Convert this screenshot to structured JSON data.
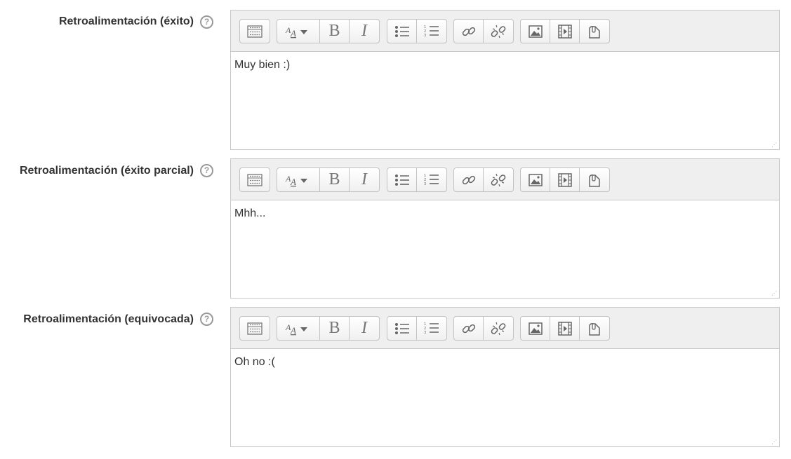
{
  "fields": [
    {
      "label": "Retroalimentación (éxito)",
      "help": "?",
      "content": "Muy bien :)"
    },
    {
      "label": "Retroalimentación (éxito parcial)",
      "help": "?",
      "content": "Mhh..."
    },
    {
      "label": "Retroalimentación (equivocada)",
      "help": "?",
      "content": "Oh no :("
    }
  ],
  "toolbar": {
    "icons": [
      "show-more-buttons-icon",
      "font-style-icon",
      "bold-icon",
      "italic-icon",
      "unordered-list-icon",
      "ordered-list-icon",
      "link-icon",
      "unlink-icon",
      "image-icon",
      "media-icon",
      "manage-files-icon"
    ],
    "bold_glyph": "B",
    "italic_glyph": "I"
  },
  "colors": {
    "toolbar_bg": "#efefef",
    "border": "#c8c8c8",
    "label_text": "#333333",
    "help_icon": "#999999"
  }
}
